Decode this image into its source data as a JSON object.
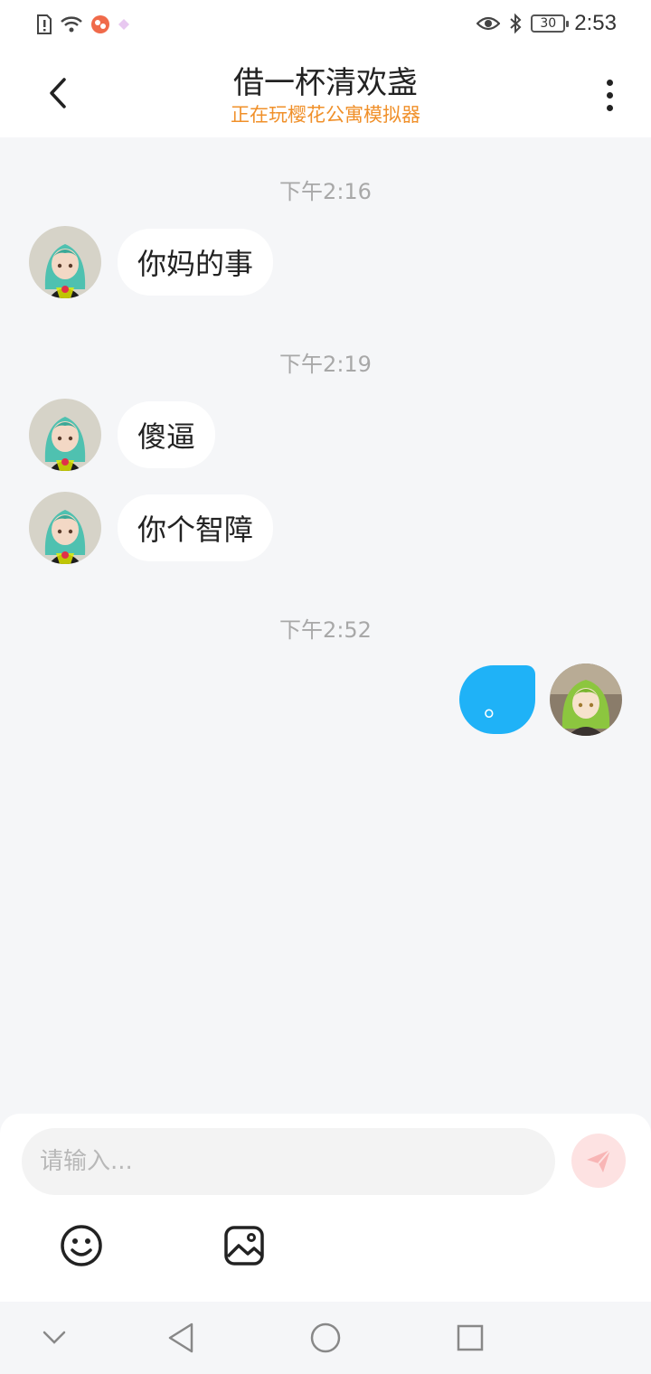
{
  "status_bar": {
    "time": "2:53",
    "battery": "30"
  },
  "header": {
    "title": "借一杯清欢盏",
    "subtitle": "正在玩樱花公寓模拟器"
  },
  "messages": [
    {
      "timestamp": "下午2:16"
    },
    {
      "text": "你妈的事"
    },
    {
      "timestamp": "下午2:19"
    },
    {
      "text": "傻逼"
    },
    {
      "text": "你个智障"
    },
    {
      "timestamp": "下午2:52"
    },
    {
      "text": "。"
    }
  ],
  "input": {
    "placeholder": "请输入..."
  },
  "colors": {
    "accent": "#1fb2f7",
    "subtitle": "#f0902a",
    "background": "#f5f6f8"
  },
  "icons": [
    "back-arrow-icon",
    "more-vertical-icon",
    "send-icon",
    "emoji-icon",
    "image-icon",
    "nav-down-icon",
    "nav-back-icon",
    "nav-home-icon",
    "nav-recents-icon"
  ]
}
